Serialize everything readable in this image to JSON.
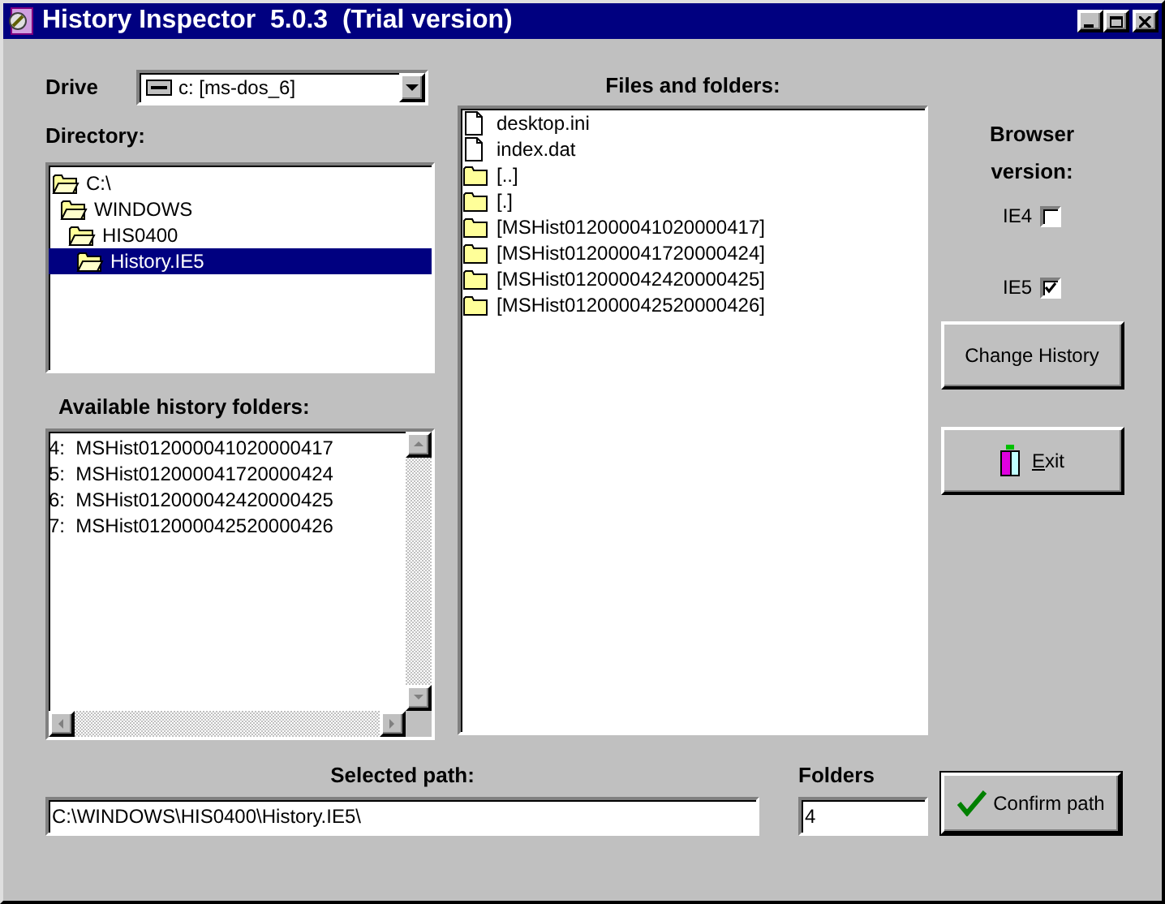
{
  "window": {
    "title": "History Inspector  5.0.3  (Trial version)"
  },
  "drive": {
    "label": "Drive",
    "value": "c: [ms-dos_6]"
  },
  "directory": {
    "label": "Directory:",
    "tree": [
      {
        "name": "C:\\",
        "selected": false,
        "children": [
          {
            "name": "WINDOWS",
            "selected": false,
            "children": [
              {
                "name": "HIS0400",
                "selected": false,
                "children": [
                  {
                    "name": "History.IE5",
                    "selected": true
                  }
                ]
              }
            ]
          }
        ]
      }
    ]
  },
  "history_folders": {
    "label": "Available history folders:",
    "items": [
      "4:  MSHist012000041020000417",
      "5:  MSHist012000041720000424",
      "6:  MSHist012000042420000425",
      "7:  MSHist012000042520000426"
    ]
  },
  "files": {
    "label": "Files and folders:",
    "items": [
      {
        "name": "desktop.ini",
        "kind": "file"
      },
      {
        "name": "index.dat",
        "kind": "file"
      },
      {
        "name": "[..]",
        "kind": "folder"
      },
      {
        "name": "[.]",
        "kind": "folder"
      },
      {
        "name": "[MSHist012000041020000417]",
        "kind": "folder"
      },
      {
        "name": "[MSHist012000041720000424]",
        "kind": "folder"
      },
      {
        "name": "[MSHist012000042420000425]",
        "kind": "folder"
      },
      {
        "name": "[MSHist012000042520000426]",
        "kind": "folder"
      }
    ]
  },
  "browser_version": {
    "label": "Browser version:",
    "options": [
      {
        "label": "IE4",
        "checked": false
      },
      {
        "label": "IE5",
        "checked": true
      }
    ]
  },
  "change_history_button": "Change History",
  "exit_button": "Exit",
  "selected_path": {
    "label": "Selected path:",
    "value": "C:\\WINDOWS\\HIS0400\\History.IE5\\"
  },
  "folders": {
    "label": "Folders",
    "value": "4"
  },
  "confirm_button": "Confirm path"
}
